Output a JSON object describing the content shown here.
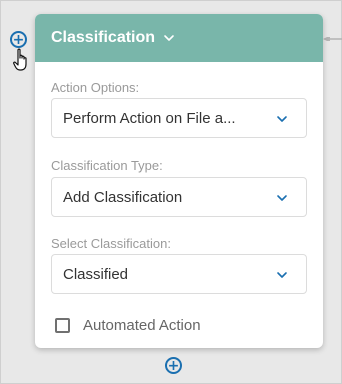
{
  "panel": {
    "title": "Classification",
    "fields": [
      {
        "label": "Action Options:",
        "value": "Perform Action on File a..."
      },
      {
        "label": "Classification Type:",
        "value": "Add Classification"
      },
      {
        "label": "Select Classification:",
        "value": "Classified"
      }
    ],
    "checkbox": {
      "label": "Automated Action",
      "checked": false
    }
  },
  "icons": {
    "add": "+",
    "add_icon_name": "plus-circle-icon",
    "dropdown_icon_name": "chevron-down-icon",
    "cursor_icon_name": "hand-pointer-icon"
  },
  "colors": {
    "header": "#79b6aa",
    "accent": "#1a6fb0",
    "background": "#e8e8e8"
  }
}
